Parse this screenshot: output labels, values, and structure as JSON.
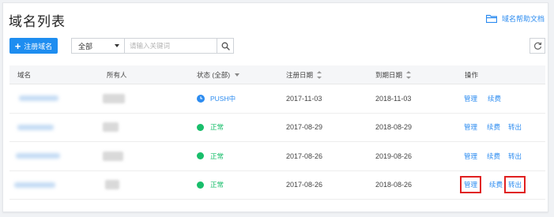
{
  "header": {
    "title": "域名列表",
    "help_link": "域名帮助文档"
  },
  "toolbar": {
    "register_label": "注册域名",
    "scope_value": "全部",
    "search_placeholder": "请输入关键词"
  },
  "table": {
    "columns": {
      "domain": "域名",
      "owner": "所有人",
      "status": "状态 (全部)",
      "reg_date": "注册日期",
      "exp_date": "到期日期",
      "actions": "操作"
    },
    "rows": [
      {
        "status": "PUSH中",
        "status_color": "#2d8cf0",
        "reg_date": "2017-11-03",
        "exp_date": "2018-11-03",
        "action_manage": "管理",
        "action_renew": "续费",
        "action_transfer": ""
      },
      {
        "status": "正常",
        "status_color": "#19be6b",
        "reg_date": "2017-08-29",
        "exp_date": "2018-08-29",
        "action_manage": "管理",
        "action_renew": "续费",
        "action_transfer": "转出"
      },
      {
        "status": "正常",
        "status_color": "#19be6b",
        "reg_date": "2017-08-26",
        "exp_date": "2019-08-26",
        "action_manage": "管理",
        "action_renew": "续费",
        "action_transfer": "转出"
      },
      {
        "status": "正常",
        "status_color": "#19be6b",
        "reg_date": "2017-08-26",
        "exp_date": "2018-08-26",
        "action_manage": "管理",
        "action_renew": "续费",
        "action_transfer": "转出"
      }
    ]
  },
  "colors": {
    "accent": "#1e8df0",
    "link": "#2d8cf0",
    "status_ok": "#19be6b",
    "highlight": "#e02020"
  }
}
